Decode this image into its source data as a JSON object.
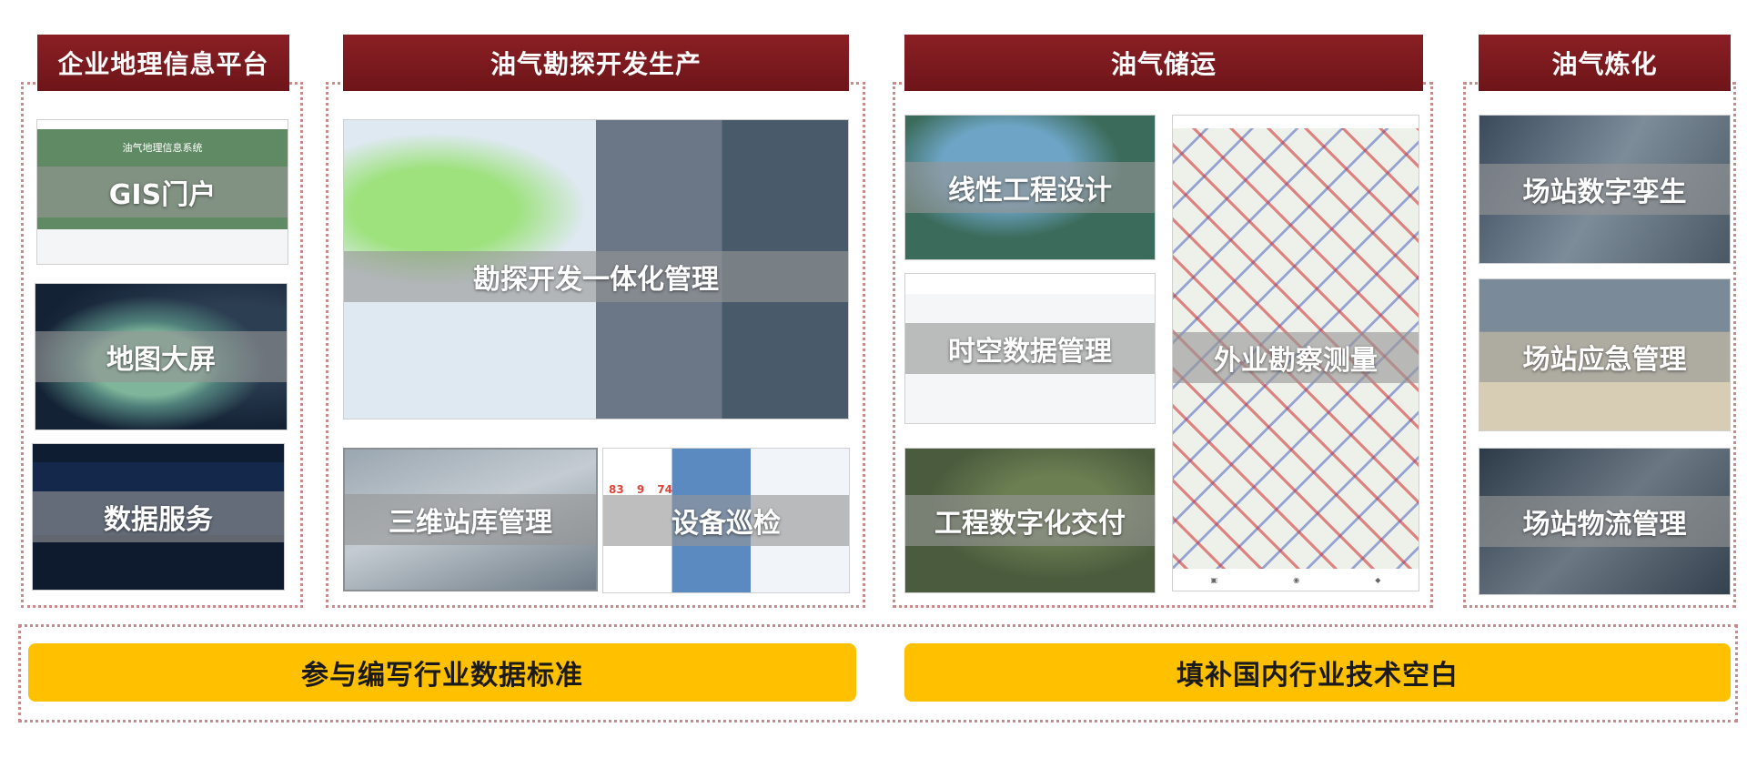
{
  "columns": [
    {
      "title": "企业地理信息平台"
    },
    {
      "title": "油气勘探开发生产"
    },
    {
      "title": "油气储运"
    },
    {
      "title": "油气炼化"
    }
  ],
  "tiles": {
    "gis_portal": "GIS门户",
    "gis_portal_system": "油气地理信息系统",
    "map_bigscreen": "地图大屏",
    "data_service": "数据服务",
    "explore_integrated": "勘探开发一体化管理",
    "station_3d": "三维站库管理",
    "equipment_patrol": "设备巡检",
    "linear_design": "线性工程设计",
    "spatiotemporal": "时空数据管理",
    "field_survey": "外业勘察测量",
    "digital_delivery": "工程数字化交付",
    "station_twin": "场站数字孪生",
    "station_emergency": "场站应急管理",
    "station_logistics": "场站物流管理"
  },
  "patrol_stats": [
    "83",
    "9",
    "74"
  ],
  "bottom": {
    "left": "参与编写行业数据标准",
    "right": "填补国内行业技术空白"
  }
}
